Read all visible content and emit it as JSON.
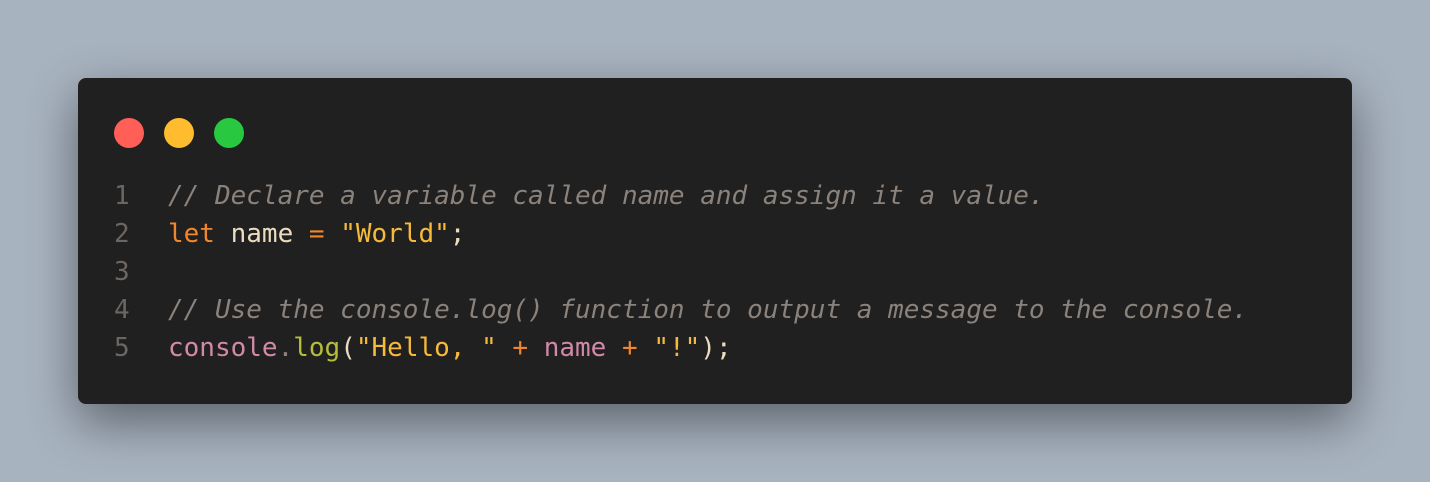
{
  "window": {
    "controls": [
      {
        "name": "close-button",
        "color": "#ff5f57"
      },
      {
        "name": "minimize-button",
        "color": "#febc2e"
      },
      {
        "name": "zoom-button",
        "color": "#28c840"
      }
    ]
  },
  "code": {
    "line_numbers": [
      "1",
      "2",
      "3",
      "4",
      "5"
    ],
    "line1": {
      "comment": "// Declare a variable called name and assign it a value."
    },
    "line2": {
      "keyword": "let",
      "space1": " ",
      "ident": "name",
      "space2": " ",
      "op": "=",
      "space3": " ",
      "string": "\"World\"",
      "semicolon": ";"
    },
    "line3": {},
    "line4": {
      "comment": "// Use the console.log() function to output a message to the console."
    },
    "line5": {
      "object": "console",
      "dot": ".",
      "method": "log",
      "open_paren": "(",
      "string1": "\"Hello, \"",
      "space1": " ",
      "op1": "+",
      "space2": " ",
      "var": "name",
      "space3": " ",
      "op2": "+",
      "space4": " ",
      "string2": "\"!\"",
      "close_paren": ")",
      "semicolon": ";"
    }
  }
}
